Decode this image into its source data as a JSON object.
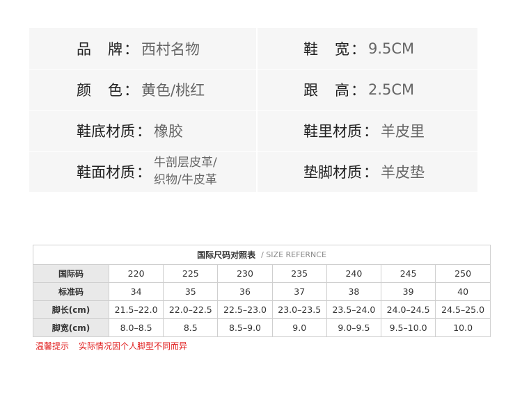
{
  "spec": {
    "brand": {
      "label": [
        "品",
        "牌"
      ],
      "value": "西村名物"
    },
    "width": {
      "label": [
        "鞋",
        "宽"
      ],
      "value": "9.5CM"
    },
    "color": {
      "label": [
        "颜",
        "色"
      ],
      "value": "黄色/桃红"
    },
    "heel": {
      "label": [
        "跟",
        "高"
      ],
      "value": "2.5CM"
    },
    "sole": {
      "label": "鞋底材质",
      "value": "橡胶"
    },
    "lining": {
      "label": "鞋里材质",
      "value": "羊皮里"
    },
    "upper": {
      "label": "鞋面材质",
      "value_line1": "牛剖层皮革/",
      "value_line2": "织物/牛皮革"
    },
    "insole": {
      "label": "垫脚材质",
      "value": "羊皮垫"
    },
    "colon": "："
  },
  "size_table": {
    "title_cn": "国际尺码对照表",
    "title_en": "/ SIZE REFERNCE",
    "rows": [
      {
        "head": "国际码",
        "cells": [
          "220",
          "225",
          "230",
          "235",
          "240",
          "245",
          "250"
        ]
      },
      {
        "head": "标准码",
        "cells": [
          "34",
          "35",
          "36",
          "37",
          "38",
          "39",
          "40"
        ]
      },
      {
        "head": "脚长(cm)",
        "cells": [
          "21.5–22.0",
          "22.0–22.5",
          "22.5–23.0",
          "23.0–23.5",
          "23.5–24.0",
          "24.0–24.5",
          "24.5–25.0"
        ]
      },
      {
        "head": "脚宽(cm)",
        "cells": [
          "8.0–8.5",
          "8.5",
          "8.5–9.0",
          "9.0",
          "9.0–9.5",
          "9.5–10.0",
          "10.0"
        ]
      }
    ]
  },
  "note": {
    "title": "温馨提示",
    "text": "实际情况因个人脚型不同而异"
  },
  "colors": {
    "note_red": "#e01e1e",
    "cell_bg": "#f6f6f6",
    "head_bg": "#e9e9e9"
  }
}
